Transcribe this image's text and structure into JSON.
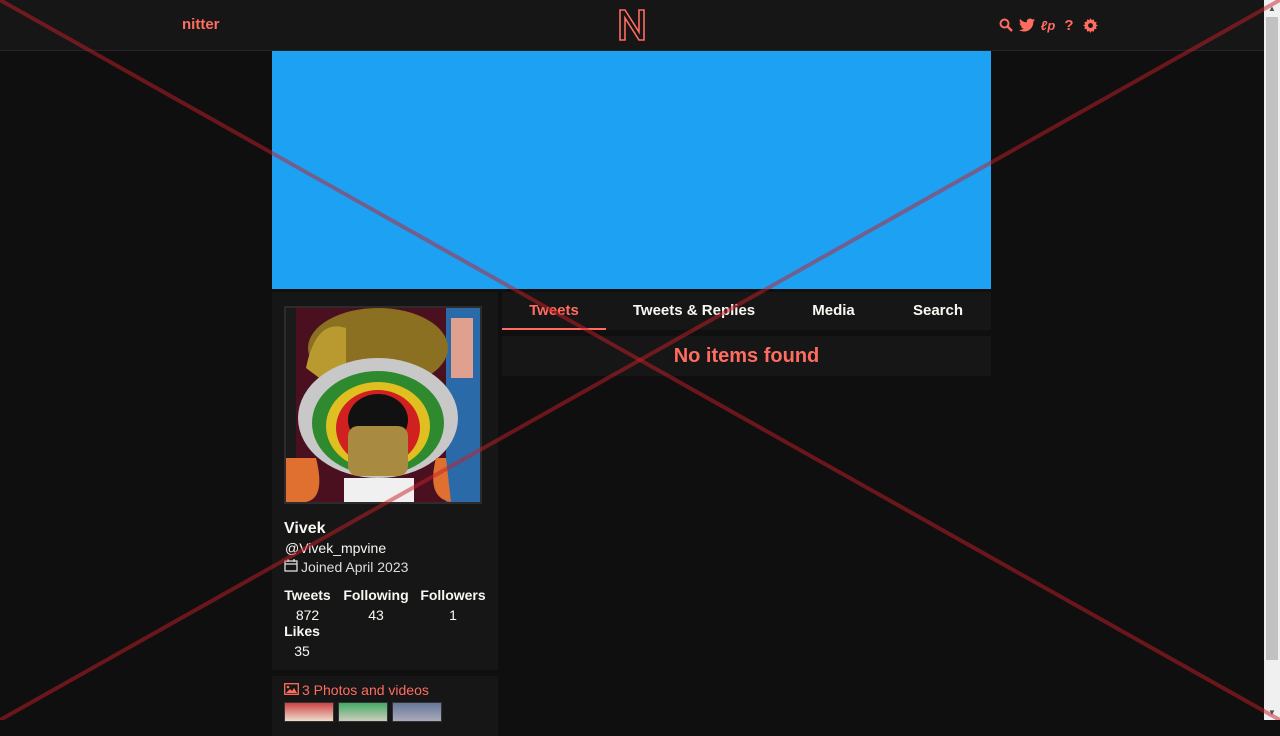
{
  "nav": {
    "brand": "nitter",
    "icons": [
      "search-icon",
      "twitter-bird-icon",
      "rss-icon",
      "help-icon",
      "gear-icon"
    ],
    "icon_glyphs": [
      "⌕",
      "🐦",
      "ℓp",
      "?",
      "⚙"
    ]
  },
  "colors": {
    "accent": "#ff6c60",
    "banner": "#1da1f2",
    "background": "#0f0f0f",
    "panel": "#161616"
  },
  "profile": {
    "fullname": "Vivek",
    "username": "@Vivek_mpvine",
    "joined": "Joined April 2023",
    "stats": {
      "tweets": {
        "label": "Tweets",
        "value": "872"
      },
      "following": {
        "label": "Following",
        "value": "43"
      },
      "followers": {
        "label": "Followers",
        "value": "1"
      },
      "likes": {
        "label": "Likes",
        "value": "35"
      }
    }
  },
  "media": {
    "label": "3 Photos and videos"
  },
  "tabs": [
    {
      "label": "Tweets",
      "active": true
    },
    {
      "label": "Tweets & Replies",
      "active": false
    },
    {
      "label": "Media",
      "active": false
    },
    {
      "label": "Search",
      "active": false
    }
  ],
  "timeline": {
    "empty_message": "No items found"
  }
}
